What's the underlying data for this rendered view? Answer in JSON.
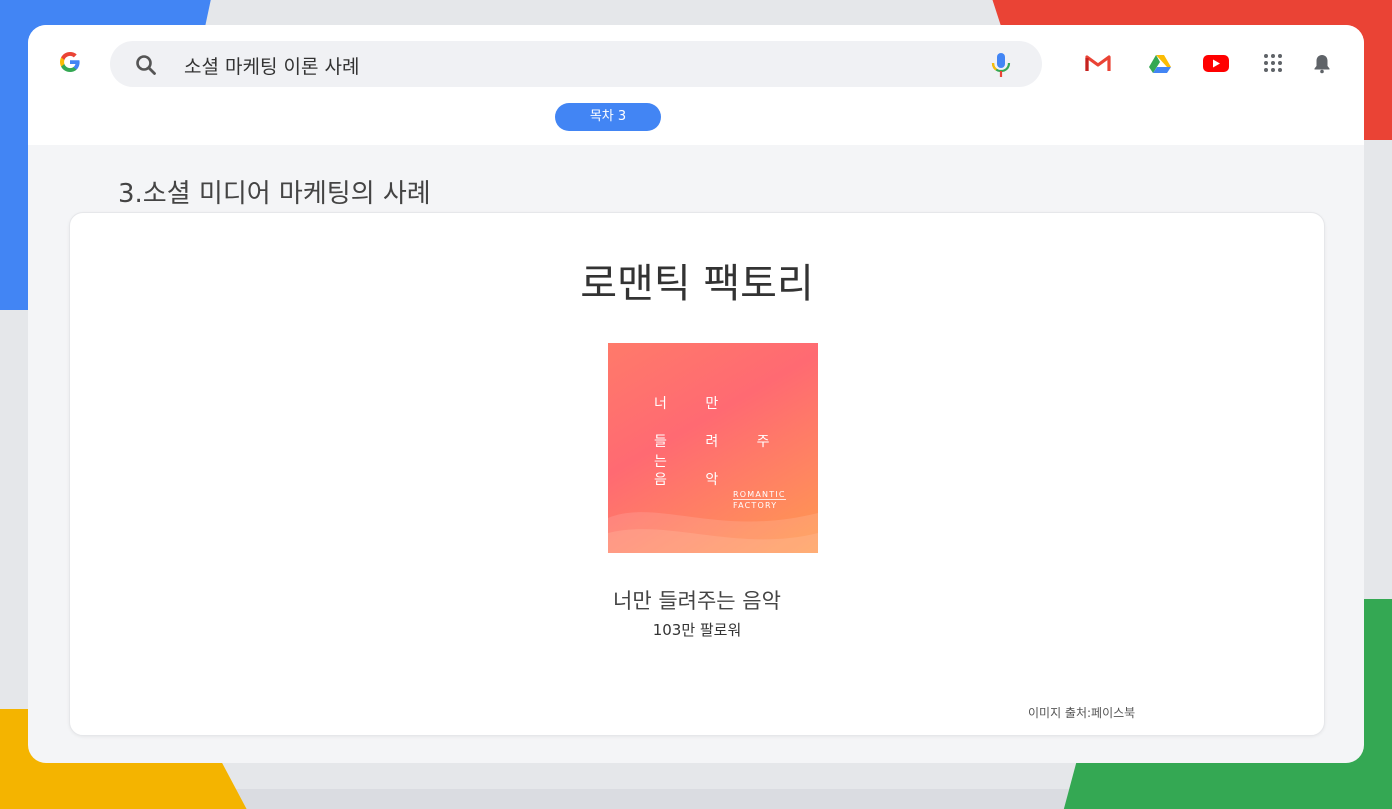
{
  "search": {
    "query": "소셜 마케팅 이론 사례"
  },
  "toc": {
    "label": "목차 3"
  },
  "section": {
    "title": "3.소셜 미디어 마케팅의 사례"
  },
  "card": {
    "title": "로맨틱 팩토리",
    "cover": {
      "line1": "너 만",
      "line2": "들 려 주 는",
      "line3": "음 악",
      "brand_line1": "ROMANTIC",
      "brand_line2": "FACTORY"
    },
    "caption": "너만 들려주는 음악",
    "followers": "103만 팔로워",
    "source": "이미지 출처:페이스북"
  },
  "icons": [
    "google-logo-icon",
    "search-icon",
    "microphone-icon",
    "gmail-icon",
    "google-drive-icon",
    "youtube-icon",
    "apps-grid-icon",
    "bell-icon"
  ],
  "colors": {
    "accent": "#4285f4",
    "red": "#ea4335",
    "yellow": "#f4b400",
    "green": "#34a853"
  }
}
